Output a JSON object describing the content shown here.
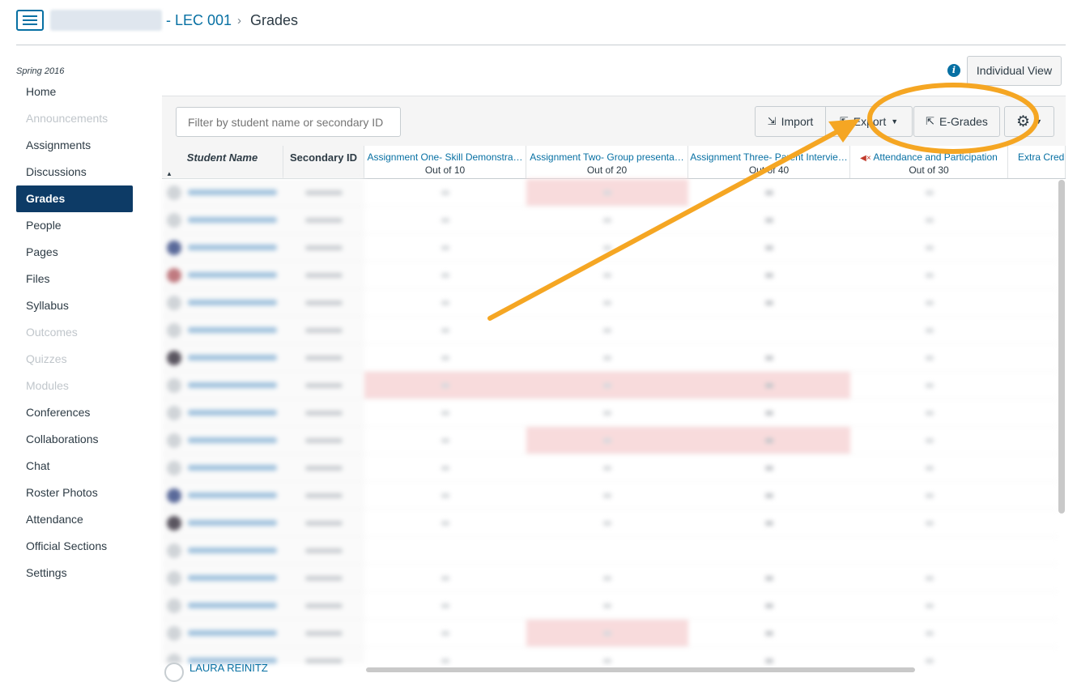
{
  "header": {
    "breadcrumb_course": "- LEC 001",
    "breadcrumb_sep": "›",
    "breadcrumb_current": "Grades"
  },
  "sidebar": {
    "term": "Spring 2016",
    "items": [
      {
        "label": "Home",
        "state": "normal"
      },
      {
        "label": "Announcements",
        "state": "disabled"
      },
      {
        "label": "Assignments",
        "state": "normal"
      },
      {
        "label": "Discussions",
        "state": "normal"
      },
      {
        "label": "Grades",
        "state": "active"
      },
      {
        "label": "People",
        "state": "normal"
      },
      {
        "label": "Pages",
        "state": "normal"
      },
      {
        "label": "Files",
        "state": "normal"
      },
      {
        "label": "Syllabus",
        "state": "normal"
      },
      {
        "label": "Outcomes",
        "state": "disabled"
      },
      {
        "label": "Quizzes",
        "state": "disabled"
      },
      {
        "label": "Modules",
        "state": "disabled"
      },
      {
        "label": "Conferences",
        "state": "normal"
      },
      {
        "label": "Collaborations",
        "state": "normal"
      },
      {
        "label": "Chat",
        "state": "normal"
      },
      {
        "label": "Roster Photos",
        "state": "normal"
      },
      {
        "label": "Attendance",
        "state": "normal"
      },
      {
        "label": "Official Sections",
        "state": "normal"
      },
      {
        "label": "Settings",
        "state": "normal"
      }
    ]
  },
  "top_right": {
    "info_icon": "info-icon",
    "individual_view_label": "Individual View"
  },
  "toolbar": {
    "filter_placeholder": "Filter by student name or secondary ID",
    "import_label": "Import",
    "export_label": "Export",
    "egrades_label": "E-Grades",
    "settings_icon": "gear-icon"
  },
  "grid": {
    "columns": {
      "student": "Student Name",
      "secondary_id": "Secondary ID",
      "a1_title": "Assignment One- Skill Demonstra…",
      "a1_sub": "Out of 10",
      "a2_title": "Assignment Two- Group presenta…",
      "a2_sub": "Out of 20",
      "a3_title": "Assignment Three- Parent Intervie…",
      "a3_sub": "Out of 40",
      "att_title": "Attendance and Participation",
      "att_sub": "Out of 30",
      "extra_title": "Extra Cred"
    },
    "visible_last_student": "LAURA REINITZ",
    "row_count_visible": 18
  },
  "colors": {
    "link": "#0770a3",
    "active_nav": "#0d3b66",
    "annotation": "#f5a623",
    "late_highlight": "#f8dbdc"
  }
}
